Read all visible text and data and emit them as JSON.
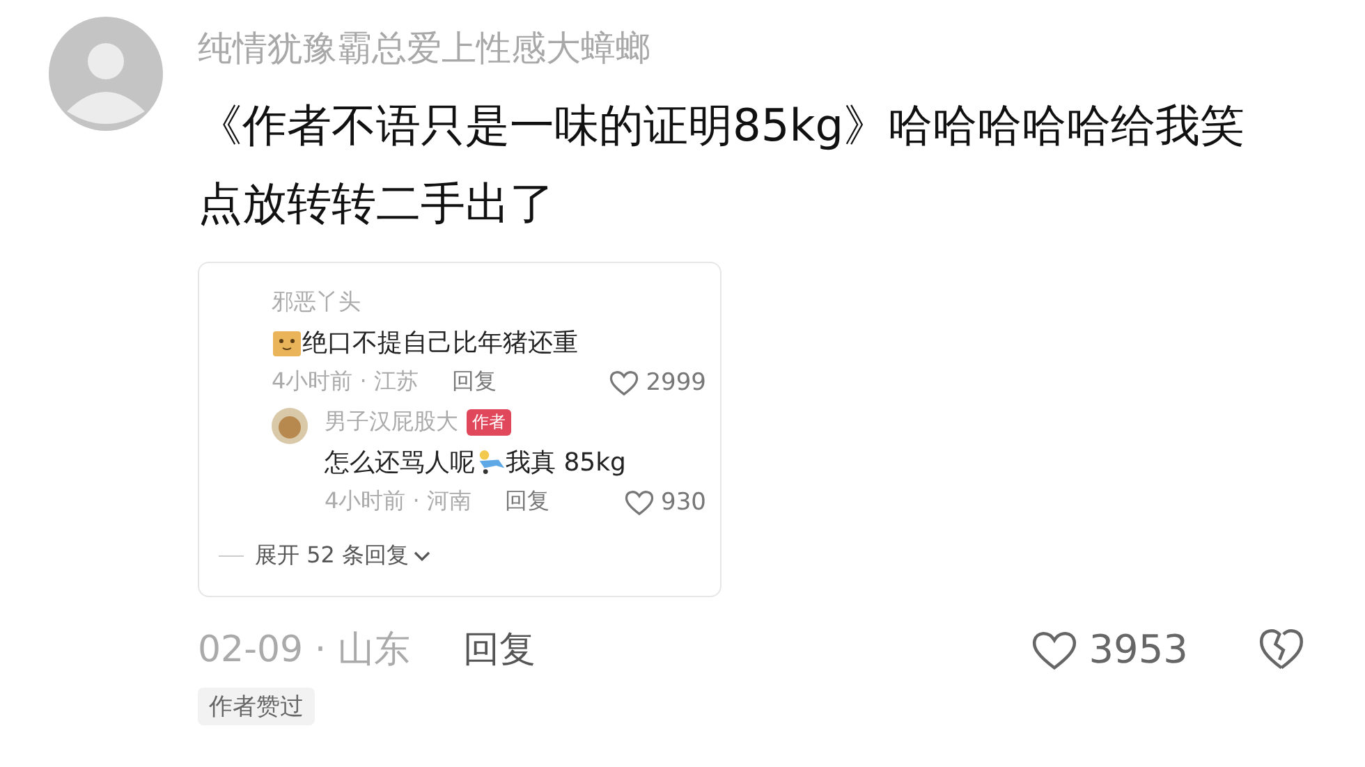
{
  "comment": {
    "author": "纯情犹豫霸总爱上性感大蟑螂",
    "text": "《作者不语只是一味的证明85kg》哈哈哈哈哈给我笑点放转转二手出了",
    "replies_card": {
      "replies": [
        {
          "author": "邪恶丫头",
          "has_avatar": false,
          "segments": [
            {
              "kind": "emoji"
            },
            {
              "kind": "text",
              "text": "绝口不提自己比年猪还重"
            }
          ],
          "meta": "4小时前 · 江苏",
          "reply_label": "回复",
          "likes": "2999"
        },
        {
          "author": "男子汉屁股大",
          "has_avatar": true,
          "badge": "作者",
          "segments": [
            {
              "kind": "text",
              "text": "怎么还骂人呢"
            },
            {
              "kind": "emoji"
            },
            {
              "kind": "text",
              "text": "我真 85kg"
            }
          ],
          "meta": "4小时前 · 河南",
          "reply_label": "回复",
          "likes": "930"
        }
      ],
      "expand": "展开 52 条回复"
    },
    "meta": "02-09 · 山东",
    "reply_label": "回复",
    "likes": "3953",
    "badge": "作者赞过"
  }
}
